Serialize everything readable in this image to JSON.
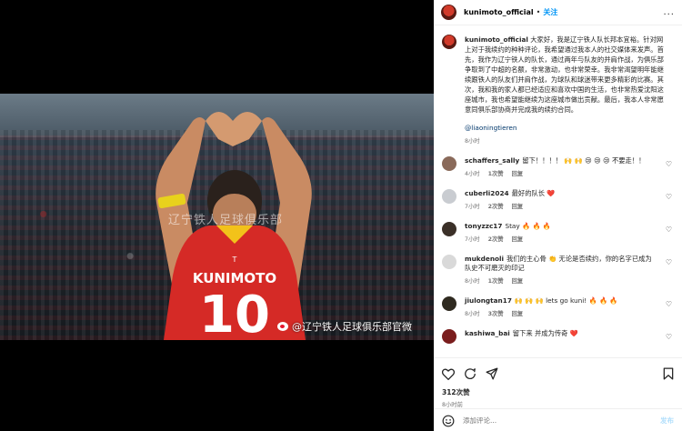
{
  "post": {
    "username": "kunimoto_official",
    "follow_label": "关注",
    "dot": "•",
    "more": "...",
    "photo": {
      "watermark_bg": "辽宁铁人足球俱乐部",
      "watermark": "@辽宁铁人足球俱乐部官微",
      "shirt_name": "KUNIMOTO",
      "shirt_number": "10"
    },
    "caption": {
      "username": "kunimoto_official",
      "text": "大家好，我是辽宁铁人队长邦本宜裕。针对网上对于我续约的种种评论，我希望通过我本人的社交媒体来发声。首先，我作为辽宁铁人的队长，通过两年与队友的并肩作战，为俱乐部争取到了中超的名额，非常激动，也非常荣幸。我非常渴望明年能继续跟铁人的队友们并肩作战，为球队和球迷带来更多精彩的比赛。其次，我和我的家人都已经适应和喜欢中国的生活，也非常热爱沈阳这座城市，我也希望能继续为这座城市做出贡献。最后，我本人非常愿意同俱乐部协商并完成我的续约合同。",
      "mention": "@liaoningtieren",
      "time": "8小时"
    },
    "comments": [
      {
        "user": "schaffers_sally",
        "text": "留下！！！！ 🙌 🙌 😢 😢 😢 不要走！！",
        "time": "4小时",
        "likes": "1次赞",
        "reply": "回复",
        "color": "#8a6a5a"
      },
      {
        "user": "cuberli2024",
        "text": "最好的队长 ❤️",
        "time": "7小时",
        "likes": "2次赞",
        "reply": "回复",
        "color": "#c9ccd1"
      },
      {
        "user": "tonyzzc17",
        "text": "Stay 🔥 🔥 🔥",
        "time": "7小时",
        "likes": "2次赞",
        "reply": "回复",
        "color": "#3b3028"
      },
      {
        "user": "mukdenoli",
        "text": "我们的主心骨 👏 无论是否续约，你的名字已成为队史不可磨灭的印记",
        "time": "8小时",
        "likes": "1次赞",
        "reply": "回复",
        "color": "#d9d9d9"
      },
      {
        "user": "jiulongtan17",
        "text": "🙌 🙌 🙌 lets go kuni! 🔥 🔥 🔥",
        "time": "8小时",
        "likes": "3次赞",
        "reply": "回复",
        "color": "#2f2a20"
      },
      {
        "user": "kashiwa_bai",
        "text": "留下来 并成为传奇 ❤️",
        "time": "",
        "likes": "",
        "reply": "",
        "color": "#7a1d1d"
      }
    ],
    "likes": "312次赞",
    "post_time": "8小时前",
    "add_comment_placeholder": "添加评论...",
    "post_label": "发布"
  }
}
